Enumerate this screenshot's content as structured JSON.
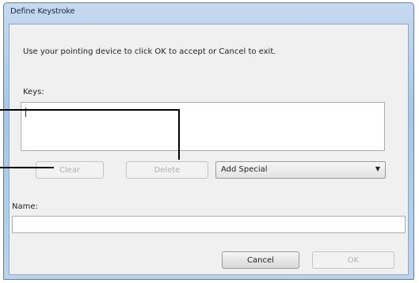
{
  "window": {
    "title": "Define Keystroke"
  },
  "instructions": "Use your pointing device to click OK to accept or Cancel to exit.",
  "keys": {
    "label": "Keys:",
    "value": ""
  },
  "buttons": {
    "clear": "Clear",
    "delete": "Delete",
    "cancel": "Cancel",
    "ok": "OK"
  },
  "add_special": {
    "selected": "Add Special"
  },
  "name": {
    "label": "Name:",
    "value": ""
  }
}
